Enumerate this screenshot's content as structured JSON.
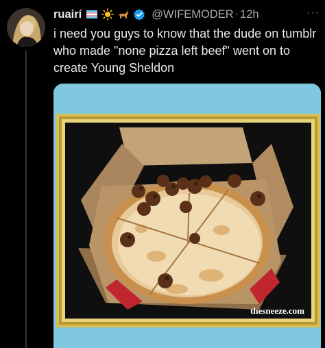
{
  "author": {
    "display_name": "ruairí",
    "handle": "@WIFEMODER",
    "separator": "·",
    "time": "12h",
    "emoji_icons": [
      "trans-flag-icon",
      "sun-icon",
      "dog-icon"
    ],
    "verified_icon": "verified-badge-icon",
    "verified_color": "#1d9bf0"
  },
  "more_label": "···",
  "tweet": {
    "text": "i need you guys to know that the dude on tumblr who made \"none pizza left beef\" went on to create Young Sheldon"
  },
  "media": {
    "watermark": "thesneeze.com",
    "frame_color": "#d8bf55",
    "background_color": "#7fc8df"
  }
}
